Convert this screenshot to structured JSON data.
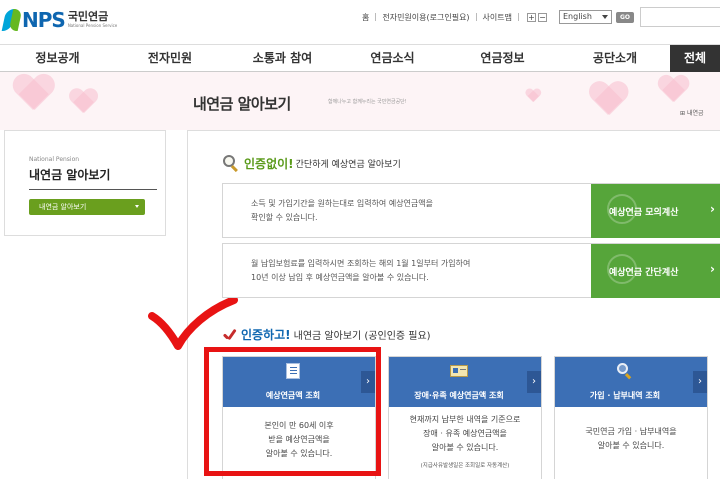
{
  "header": {
    "logo_text": "NPS",
    "logo_ko": "국민연금",
    "logo_en": "National Pension Service",
    "util_links": [
      "홈",
      "전자민원이용(로그인필요)",
      "사이트맵"
    ],
    "zoom_in": "+",
    "zoom_out": "−",
    "language": "English",
    "go": "GO"
  },
  "gnb": [
    "정보공개",
    "전자민원",
    "소통과 참여",
    "연금소식",
    "연금정보",
    "공단소개",
    "전체"
  ],
  "hero": {
    "title": "내연금 알아보기",
    "slogan": "함께나누고 함께누리는 국민연금공단!",
    "breadcrumb": "내연금"
  },
  "sidebar": {
    "en_label": "National Pension",
    "title": "내연금 알아보기",
    "select_value": "내연금 알아보기"
  },
  "section1": {
    "em": "인증없이!",
    "rest": "간단하게 예상연금 알아보기",
    "rows": [
      {
        "desc_1": "소득 및 가입기간을 원하는대로 입력하여 예상연금액을",
        "desc_2": "확인할 수 있습니다.",
        "button": "예상연금 모의계산"
      },
      {
        "desc_1": "월 납입보험료를 입력하시면 조회하는 해의 1월 1일부터 가입하여",
        "desc_2": "10년 이상 납입 후 예상연금액을 알아볼 수 있습니다.",
        "button": "예상연금 간단계산"
      }
    ]
  },
  "section2": {
    "em": "인증하고!",
    "rest": "내연금 알아보기 (공인인증 필요)",
    "cards": [
      {
        "title": "예상연금액 조회",
        "desc_1": "본인이 만 60세 이후",
        "desc_2": "받을 예상연금액을",
        "desc_3": "알아볼 수 있습니다.",
        "note": ""
      },
      {
        "title": "장애·유족 예상연금액 조회",
        "desc_1": "현재까지 납부한 내역을 기준으로",
        "desc_2": "장애 · 유족 예상연금액을",
        "desc_3": "알아볼 수 있습니다.",
        "note": "(지급사유발생일은 조회일로 자동계산)"
      },
      {
        "title": "가입 · 납부내역 조회",
        "desc_1": "국민연금 가입 · 납부내역을",
        "desc_2": "알아볼 수 있습니다.",
        "desc_3": "",
        "note": ""
      }
    ]
  },
  "icons": {
    "section1": "magnifier-icon",
    "section2": "check-icon",
    "card1": "document-icon",
    "card2": "id-card-icon",
    "card3": "search-icon"
  },
  "colors": {
    "brand_blue": "#0e66b0",
    "green_button": "#56a53a",
    "card_blue": "#3c6fb5",
    "highlight_red": "#e81313"
  }
}
